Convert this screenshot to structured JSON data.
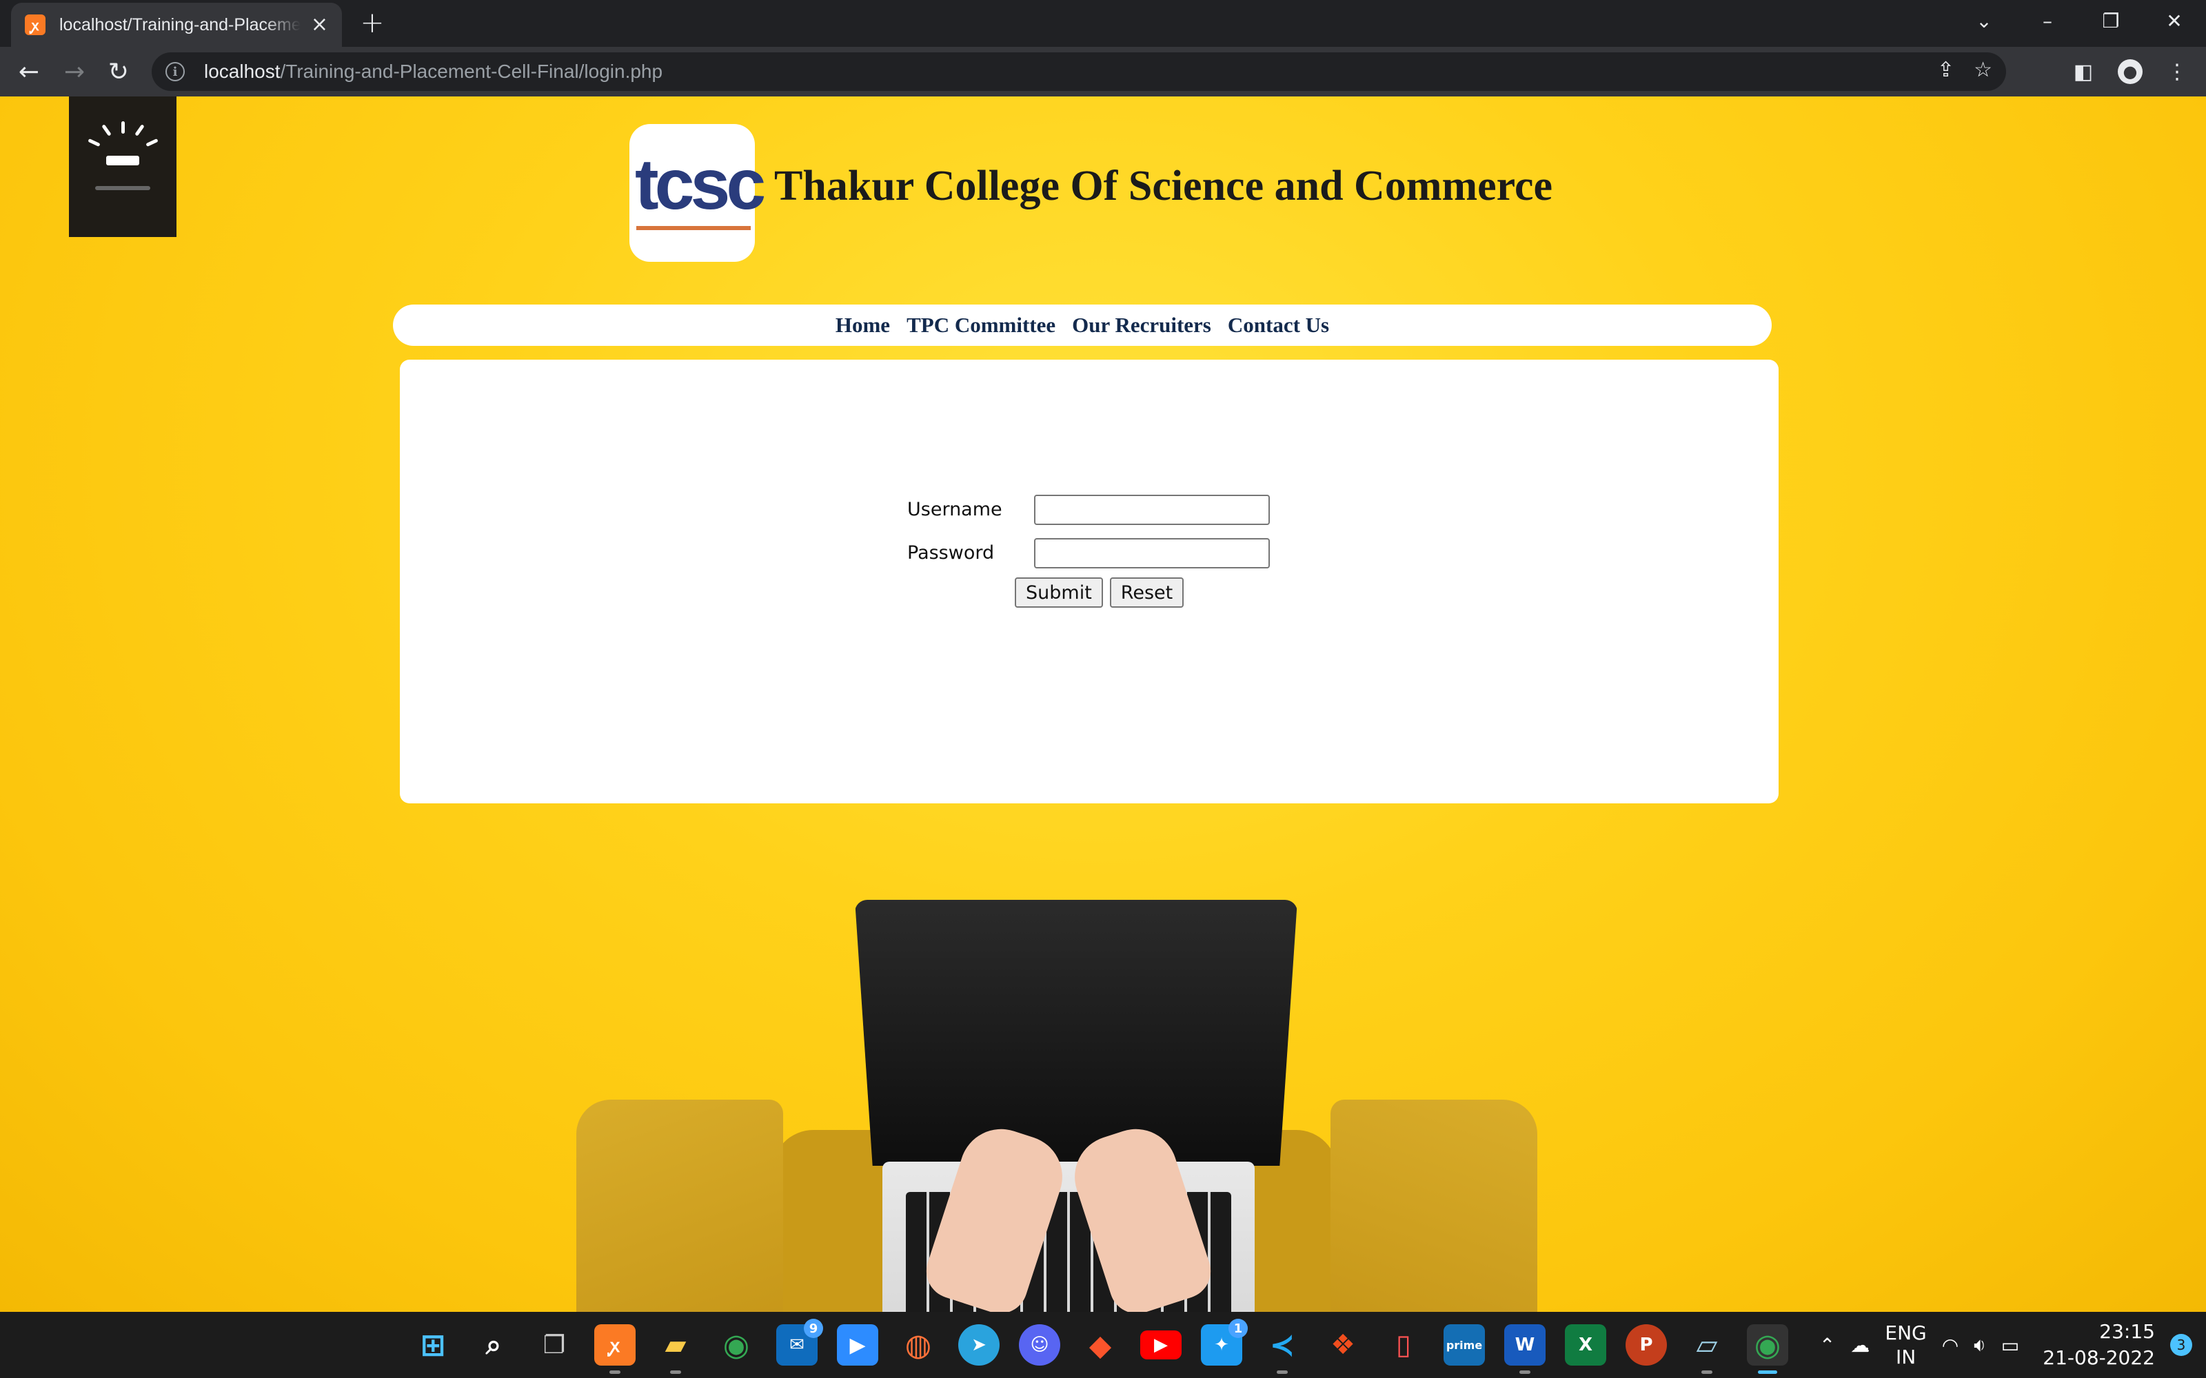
{
  "browser": {
    "tab_title": "localhost/Training-and-Placement-Cell-Final/login.php",
    "url_host": "localhost",
    "url_path": "/Training-and-Placement-Cell-Final/login.php"
  },
  "page": {
    "logo_text": "tcsc",
    "college_name": "Thakur College Of Science and Commerce",
    "nav": [
      "Home",
      "TPC Committee",
      "Our Recruiters",
      "Contact Us"
    ],
    "form": {
      "username_label": "Username",
      "password_label": "Password",
      "username_value": "",
      "password_value": "",
      "submit_label": "Submit",
      "reset_label": "Reset"
    },
    "colors": {
      "background_yellow": "#ffd21a",
      "nav_text": "#132a4d",
      "logo_blue": "#2a3c7c",
      "logo_orange": "#d8743b"
    }
  },
  "taskbar": {
    "apps": [
      "windows-start",
      "search",
      "task-view",
      "xampp",
      "file-explorer",
      "chrome",
      "mail",
      "zoom",
      "firefox",
      "telegram",
      "discord",
      "brave",
      "youtube",
      "twitter",
      "vscode",
      "figma",
      "phone-link",
      "prime-video",
      "word",
      "excel",
      "powerpoint",
      "notes",
      "chrome-active"
    ],
    "mail_badge": "9",
    "twitter_badge": "1",
    "language": "ENG",
    "region": "IN",
    "time": "23:15",
    "date": "21-08-2022",
    "notification_count": "3"
  }
}
